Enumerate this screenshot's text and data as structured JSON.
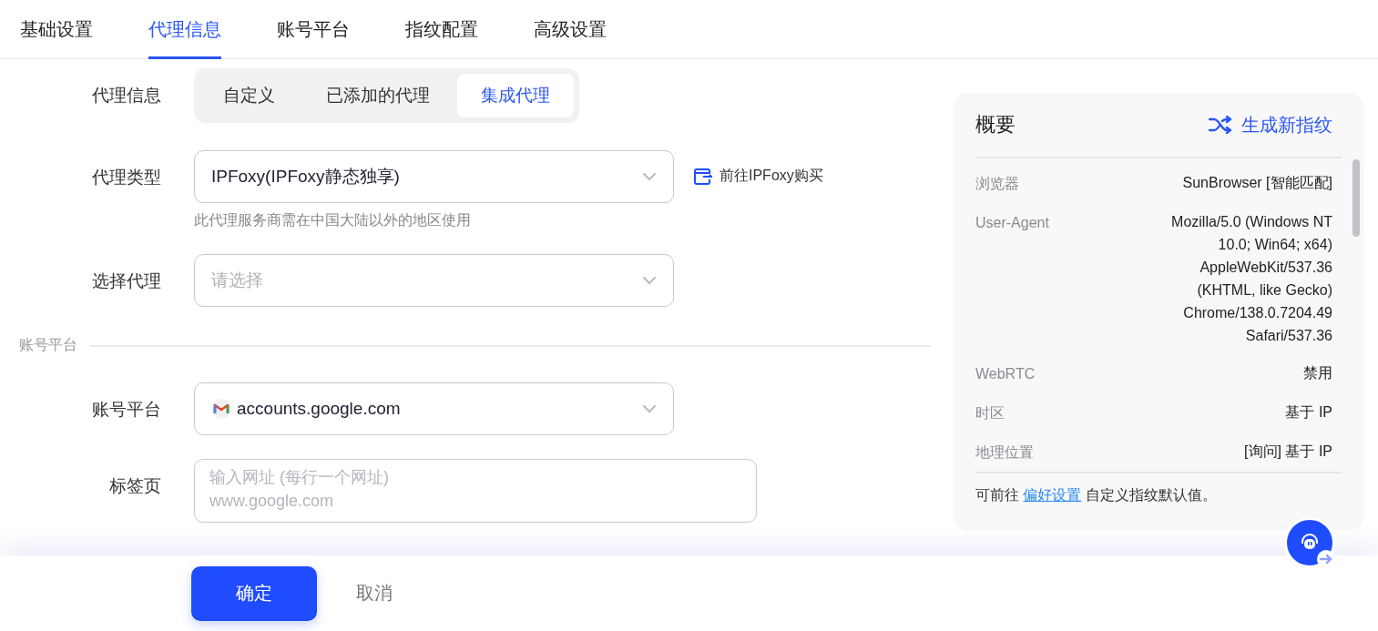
{
  "tabs": [
    {
      "label": "基础设置",
      "selected": false
    },
    {
      "label": "代理信息",
      "selected": true
    },
    {
      "label": "账号平台",
      "selected": false
    },
    {
      "label": "指纹配置",
      "selected": false
    },
    {
      "label": "高级设置",
      "selected": false
    }
  ],
  "proxy_mode": {
    "label": "代理信息",
    "options": [
      {
        "label": "自定义",
        "selected": false
      },
      {
        "label": "已添加的代理",
        "selected": false
      },
      {
        "label": "集成代理",
        "selected": true
      }
    ]
  },
  "proxy_type": {
    "label": "代理类型",
    "value": "IPFoxy(IPFoxy静态独享)",
    "link": "前往IPFoxy购买",
    "hint": "此代理服务商需在中国大陆以外的地区使用"
  },
  "proxy_select": {
    "label": "选择代理",
    "placeholder": "请选择"
  },
  "section_title": "账号平台",
  "platform": {
    "label": "账号平台",
    "value": "accounts.google.com"
  },
  "tab_urls": {
    "label": "标签页",
    "placeholder": "输入网址 (每行一个网址)\nwww.google.com"
  },
  "overview": {
    "title": "概要",
    "action": "生成新指纹",
    "rows": [
      {
        "label": "浏览器",
        "value": "SunBrowser [智能匹配]"
      },
      {
        "label": "User-Agent",
        "value": "Mozilla/5.0 (Windows NT 10.0; Win64; x64) AppleWebKit/537.36 (KHTML, like Gecko) Chrome/138.0.7204.49 Safari/537.36"
      },
      {
        "label": "WebRTC",
        "value": "禁用"
      },
      {
        "label": "时区",
        "value": "基于 IP"
      },
      {
        "label": "地理位置",
        "value": "[询问] 基于 IP"
      }
    ],
    "note_before": "可前往",
    "note_link": "偏好设置",
    "note_after": "自定义指纹默认值。"
  },
  "buttons": {
    "confirm": "确定",
    "cancel": "取消"
  }
}
